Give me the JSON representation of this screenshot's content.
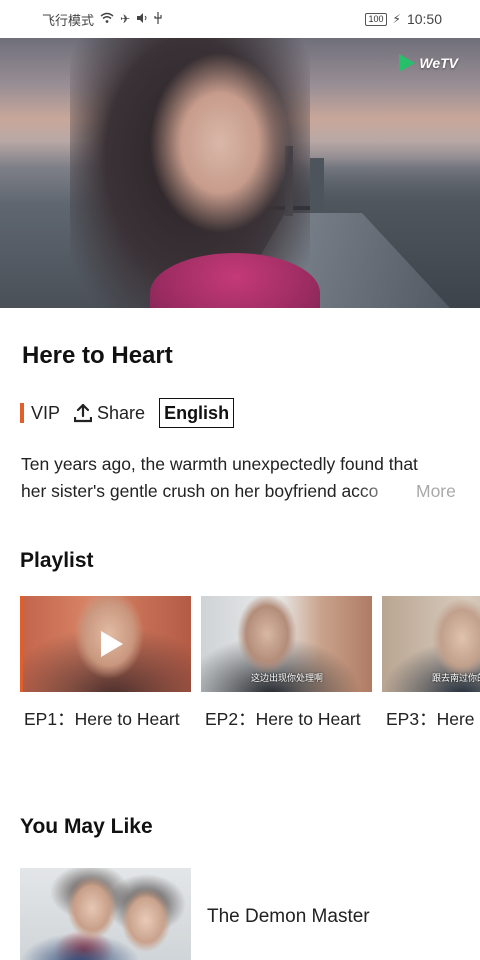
{
  "status_bar": {
    "left_text": "飞行模式",
    "battery": "100",
    "time": "10:50"
  },
  "hero": {
    "logo_text": "WeTV"
  },
  "show": {
    "title": "Here to Heart",
    "vip_label": "VIP",
    "share_label": "Share",
    "language_label": "English",
    "description_line1": "Ten years ago, the warmth unexpectedly found that",
    "description_line2": "her sister's gentle crush on her boyfriend acco",
    "more_label": "More"
  },
  "playlist": {
    "title": "Playlist",
    "episodes": [
      {
        "label": "EP1：Here to Heart",
        "subtitle": ""
      },
      {
        "label": "EP2：Here to Heart",
        "subtitle": "这边出现你处理啊"
      },
      {
        "label": "EP3：Here",
        "subtitle": "跟去南过你的"
      }
    ]
  },
  "recommendations": {
    "title": "You May Like",
    "items": [
      {
        "title": "The Demon Master"
      }
    ]
  },
  "colors": {
    "accent": "#e0602b",
    "brand_green": "#26c06a",
    "more_gray": "#a9a9a9"
  }
}
